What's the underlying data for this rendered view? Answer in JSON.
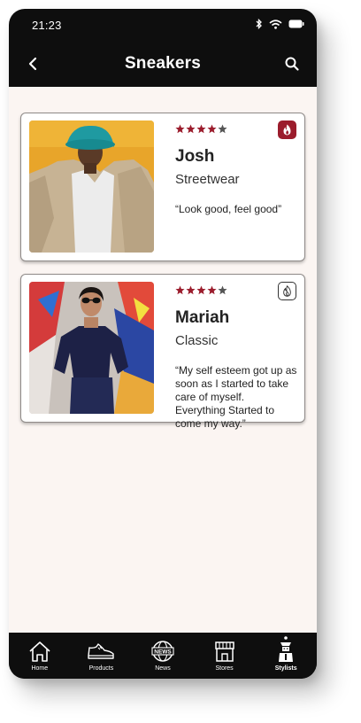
{
  "status": {
    "time": "21:23"
  },
  "header": {
    "title": "Sneakers"
  },
  "stylists": [
    {
      "name": "Josh",
      "style": "Streetwear",
      "rating": 4,
      "featured": true,
      "quote": "“Look good, feel good”"
    },
    {
      "name": "Mariah",
      "style": "Classic",
      "rating": 4,
      "featured": false,
      "quote": "“My self esteem got up as soon as I started to take care of myself. Everything Started to come my way.”"
    }
  ],
  "tabs": [
    {
      "label": "Home",
      "icon": "home-icon"
    },
    {
      "label": "Products",
      "icon": "sneaker-icon"
    },
    {
      "label": "News",
      "icon": "news-globe-icon"
    },
    {
      "label": "Stores",
      "icon": "storefront-icon"
    },
    {
      "label": "Stylists",
      "icon": "stylist-icon",
      "active": true
    }
  ],
  "colors": {
    "accent": "#9b1c2c",
    "bar": "#0e0e0e",
    "content_bg": "#fbf5f2"
  }
}
